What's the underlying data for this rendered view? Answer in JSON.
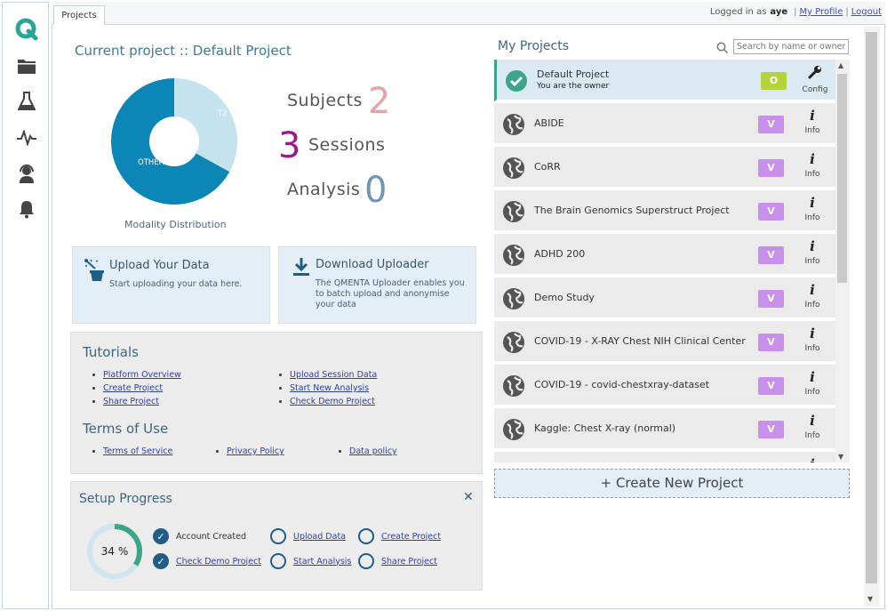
{
  "topbar": {
    "tab_label": "Projects",
    "logged_in_text": "Logged in as",
    "username": "aye",
    "my_profile": "My Profile",
    "logout": "Logout"
  },
  "sidebar": {
    "items": [
      {
        "icon": "qmenta-logo-icon"
      },
      {
        "icon": "folder-icon"
      },
      {
        "icon": "flask-icon"
      },
      {
        "icon": "activity-icon"
      },
      {
        "icon": "support-agent-icon"
      },
      {
        "icon": "bell-icon"
      }
    ]
  },
  "current_project": {
    "title": "Current project :: Default Project",
    "modality_caption": "Modality Distribution",
    "modality": [
      {
        "label": "T2",
        "fraction": 0.33,
        "color": "#c5e3ee"
      },
      {
        "label": "OTHER",
        "fraction": 0.67,
        "color": "#0c86b6"
      }
    ],
    "subjects_label": "Subjects",
    "subjects_value": "2",
    "sessions_label": "Sessions",
    "sessions_value": "3",
    "analysis_label": "Analysis",
    "analysis_value": "0"
  },
  "upload": {
    "title": "Upload Your Data",
    "text": "Start uploading your data here."
  },
  "download": {
    "title": "Download Uploader",
    "text": "The QMENTA Uploader enables you to batch upload and anonymise your data"
  },
  "tutorials": {
    "heading": "Tutorials",
    "col1": [
      "Platform Overview",
      "Create Project",
      "Share Project"
    ],
    "col2": [
      "Upload Session Data",
      "Start New Analysis",
      "Check Demo Project"
    ],
    "terms_heading": "Terms of Use",
    "terms": [
      "Terms of Service",
      "Privacy Policy",
      "Data policy"
    ]
  },
  "setup": {
    "heading": "Setup Progress",
    "percent_label": "34 %",
    "progress": 0.34,
    "items": [
      {
        "label": "Account Created",
        "done": true,
        "link": false
      },
      {
        "label": "Upload Data",
        "done": false,
        "link": true
      },
      {
        "label": "Create Project",
        "done": false,
        "link": true
      },
      {
        "label": "Check Demo Project",
        "done": true,
        "link": true
      },
      {
        "label": "Start Analysis",
        "done": false,
        "link": true
      },
      {
        "label": "Share Project",
        "done": false,
        "link": true
      }
    ]
  },
  "my_projects": {
    "title": "My Projects",
    "search_placeholder": "Search by name or owner",
    "create_label": "+ Create New Project",
    "projects": [
      {
        "name": "Default Project",
        "sub": "You are the owner",
        "badge": "O",
        "action": "Config",
        "active": true
      },
      {
        "name": "ABIDE",
        "badge": "V",
        "action": "Info"
      },
      {
        "name": "CoRR",
        "badge": "V",
        "action": "Info"
      },
      {
        "name": "The Brain Genomics Superstruct Project",
        "badge": "V",
        "action": "Info"
      },
      {
        "name": "ADHD 200",
        "badge": "V",
        "action": "Info"
      },
      {
        "name": "Demo Study",
        "badge": "V",
        "action": "Info"
      },
      {
        "name": "COVID-19 - X-RAY Chest NIH Clinical Center",
        "badge": "V",
        "action": "Info"
      },
      {
        "name": "COVID-19 - covid-chestxray-dataset",
        "badge": "V",
        "action": "Info"
      },
      {
        "name": "Kaggle: Chest X-ray (normal)",
        "badge": "V",
        "action": "Info"
      },
      {
        "name": "",
        "badge": "",
        "action": ""
      }
    ],
    "colors": {
      "owner_badge": "#b4d23a",
      "viewer_badge": "#c98fed",
      "accent": "#3aa58a"
    }
  }
}
